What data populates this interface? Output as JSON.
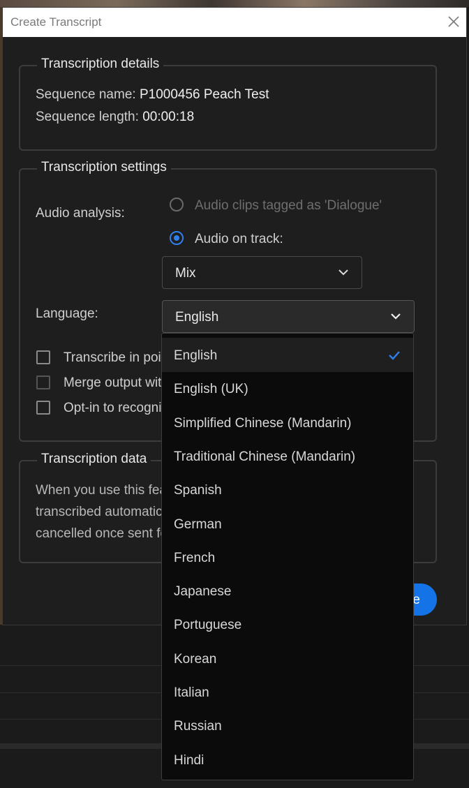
{
  "dialog": {
    "title": "Create Transcript",
    "close_icon": "close-icon"
  },
  "details": {
    "legend": "Transcription details",
    "sequence_name_label": "Sequence name:",
    "sequence_name_value": "P1000456 Peach Test",
    "sequence_length_label": "Sequence length:",
    "sequence_length_value": "00:00:18"
  },
  "settings": {
    "legend": "Transcription settings",
    "audio_analysis_label": "Audio analysis:",
    "radio_dialogue_label": "Audio clips tagged as 'Dialogue'",
    "radio_track_label": "Audio on track:",
    "track_select_value": "Mix",
    "language_label": "Language:",
    "language_select_value": "English",
    "checkbox_1_label": "Transcribe in poir",
    "checkbox_2_label": "Merge output wit",
    "checkbox_3_label": "Opt-in to recogni"
  },
  "data_section": {
    "legend": "Transcription data",
    "line1": "When you use this fea",
    "line2": "transcribed automatic",
    "line3": "cancelled once sent fo"
  },
  "primary_button": {
    "label": "e"
  },
  "language_menu": {
    "items": [
      "English",
      "English (UK)",
      "Simplified Chinese (Mandarin)",
      "Traditional Chinese (Mandarin)",
      "Spanish",
      "German",
      "French",
      "Japanese",
      "Portuguese",
      "Korean",
      "Italian",
      "Russian",
      "Hindi"
    ],
    "selected": "English"
  },
  "colors": {
    "accent": "#2f80ed",
    "button": "#1473e6",
    "dialog_bg": "#1e1e1e",
    "menu_bg": "#0b0b0b"
  }
}
